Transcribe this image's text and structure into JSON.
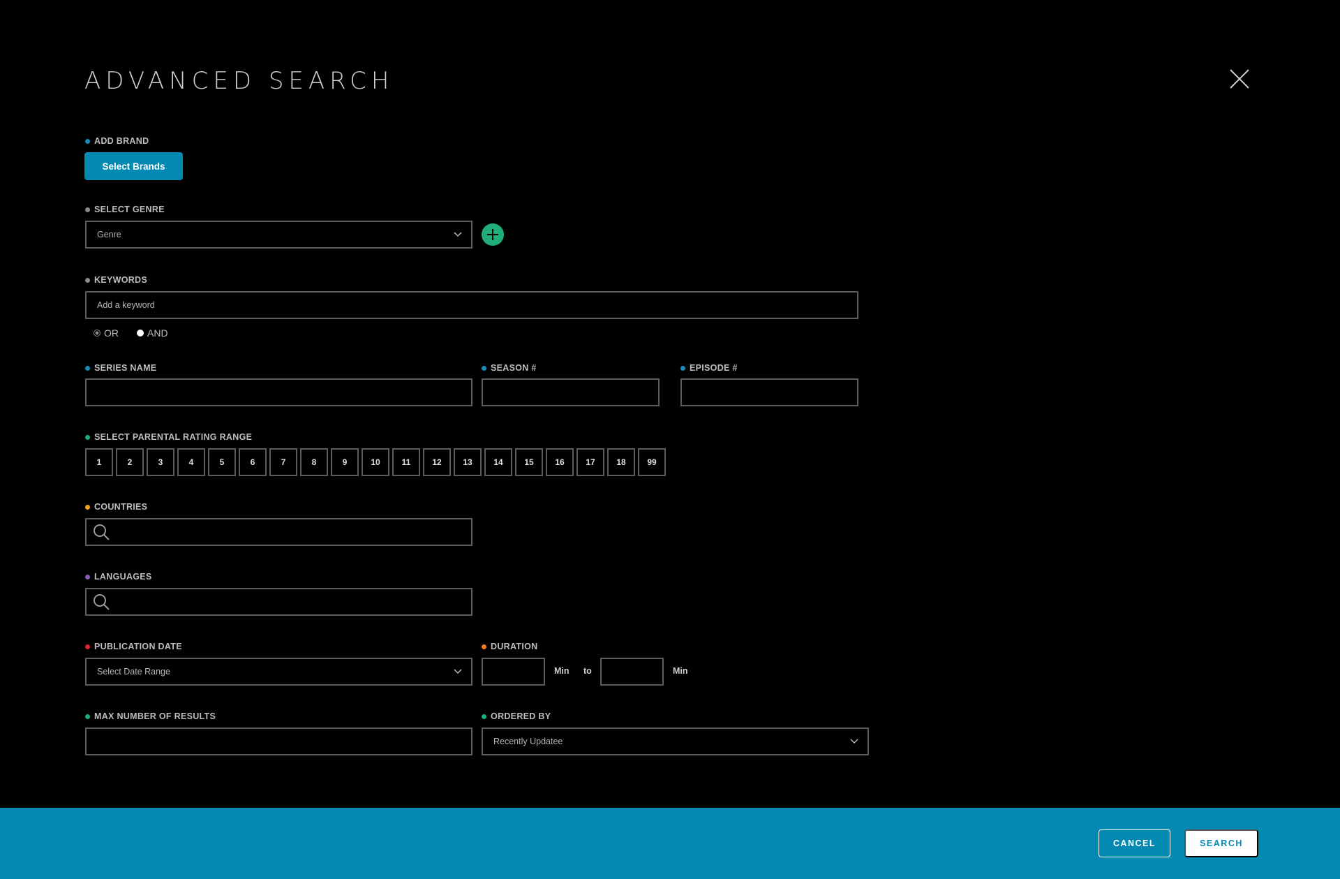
{
  "title": "ADVANCED SEARCH",
  "colors": {
    "accent": "#0389b2",
    "add_green": "#1fae7a",
    "dot_blue": "#1a8cb7",
    "dot_gray": "#8a8a8a",
    "dot_green": "#1fae7a",
    "dot_orange": "#f1a21a",
    "dot_purple": "#8a5bb5",
    "dot_red": "#d8252f",
    "dot_orange2": "#f47b20"
  },
  "brand": {
    "label": "ADD BRAND",
    "button": "Select Brands"
  },
  "genre": {
    "label": "SELECT GENRE",
    "placeholder": "Genre"
  },
  "keywords": {
    "label": "KEYWORDS",
    "placeholder": "Add a keyword",
    "options": [
      "OR",
      "AND"
    ]
  },
  "series": {
    "label": "SERIES NAME",
    "value": ""
  },
  "season": {
    "label": "SEASON #",
    "value": ""
  },
  "episode": {
    "label": "EPISODE #",
    "value": ""
  },
  "rating": {
    "label": "SELECT PARENTAL RATING RANGE",
    "values": [
      "1",
      "2",
      "3",
      "4",
      "5",
      "6",
      "7",
      "8",
      "9",
      "10",
      "11",
      "12",
      "13",
      "14",
      "15",
      "16",
      "17",
      "18",
      "99"
    ]
  },
  "countries": {
    "label": "COUNTRIES",
    "value": ""
  },
  "languages": {
    "label": "LANGUAGES",
    "value": ""
  },
  "publication": {
    "label": "PUBLICATION DATE",
    "placeholder": "Select Date Range"
  },
  "duration": {
    "label": "DURATION",
    "unit": "Min",
    "to": "to"
  },
  "max_results": {
    "label": "MAX NUMBER OF RESULTS",
    "value": ""
  },
  "ordered": {
    "label": "ORDERED BY",
    "value": "Recently Updatee"
  },
  "footer": {
    "cancel": "CANCEL",
    "search": "SEARCH"
  }
}
